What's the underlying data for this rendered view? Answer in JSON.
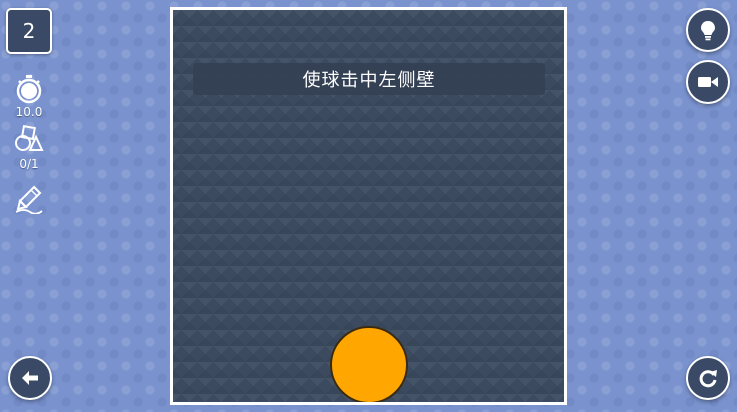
{
  "level": {
    "number": "2"
  },
  "stats": {
    "time_value": "10.0",
    "shapes_value": "0/1"
  },
  "board": {
    "goal_text": "使球击中左侧壁"
  },
  "colors": {
    "background": "#7a93cf",
    "board": "#3b4a5f",
    "ball": "#ffa600",
    "button": "#3a4a66",
    "accent_white": "#ffffff"
  },
  "icons": {
    "timer": "stopwatch-icon",
    "shapes": "shapes-icon",
    "draw": "pencil-icon",
    "hint": "lightbulb-icon",
    "video": "video-camera-icon",
    "back": "arrow-left-icon",
    "restart": "restart-icon"
  }
}
